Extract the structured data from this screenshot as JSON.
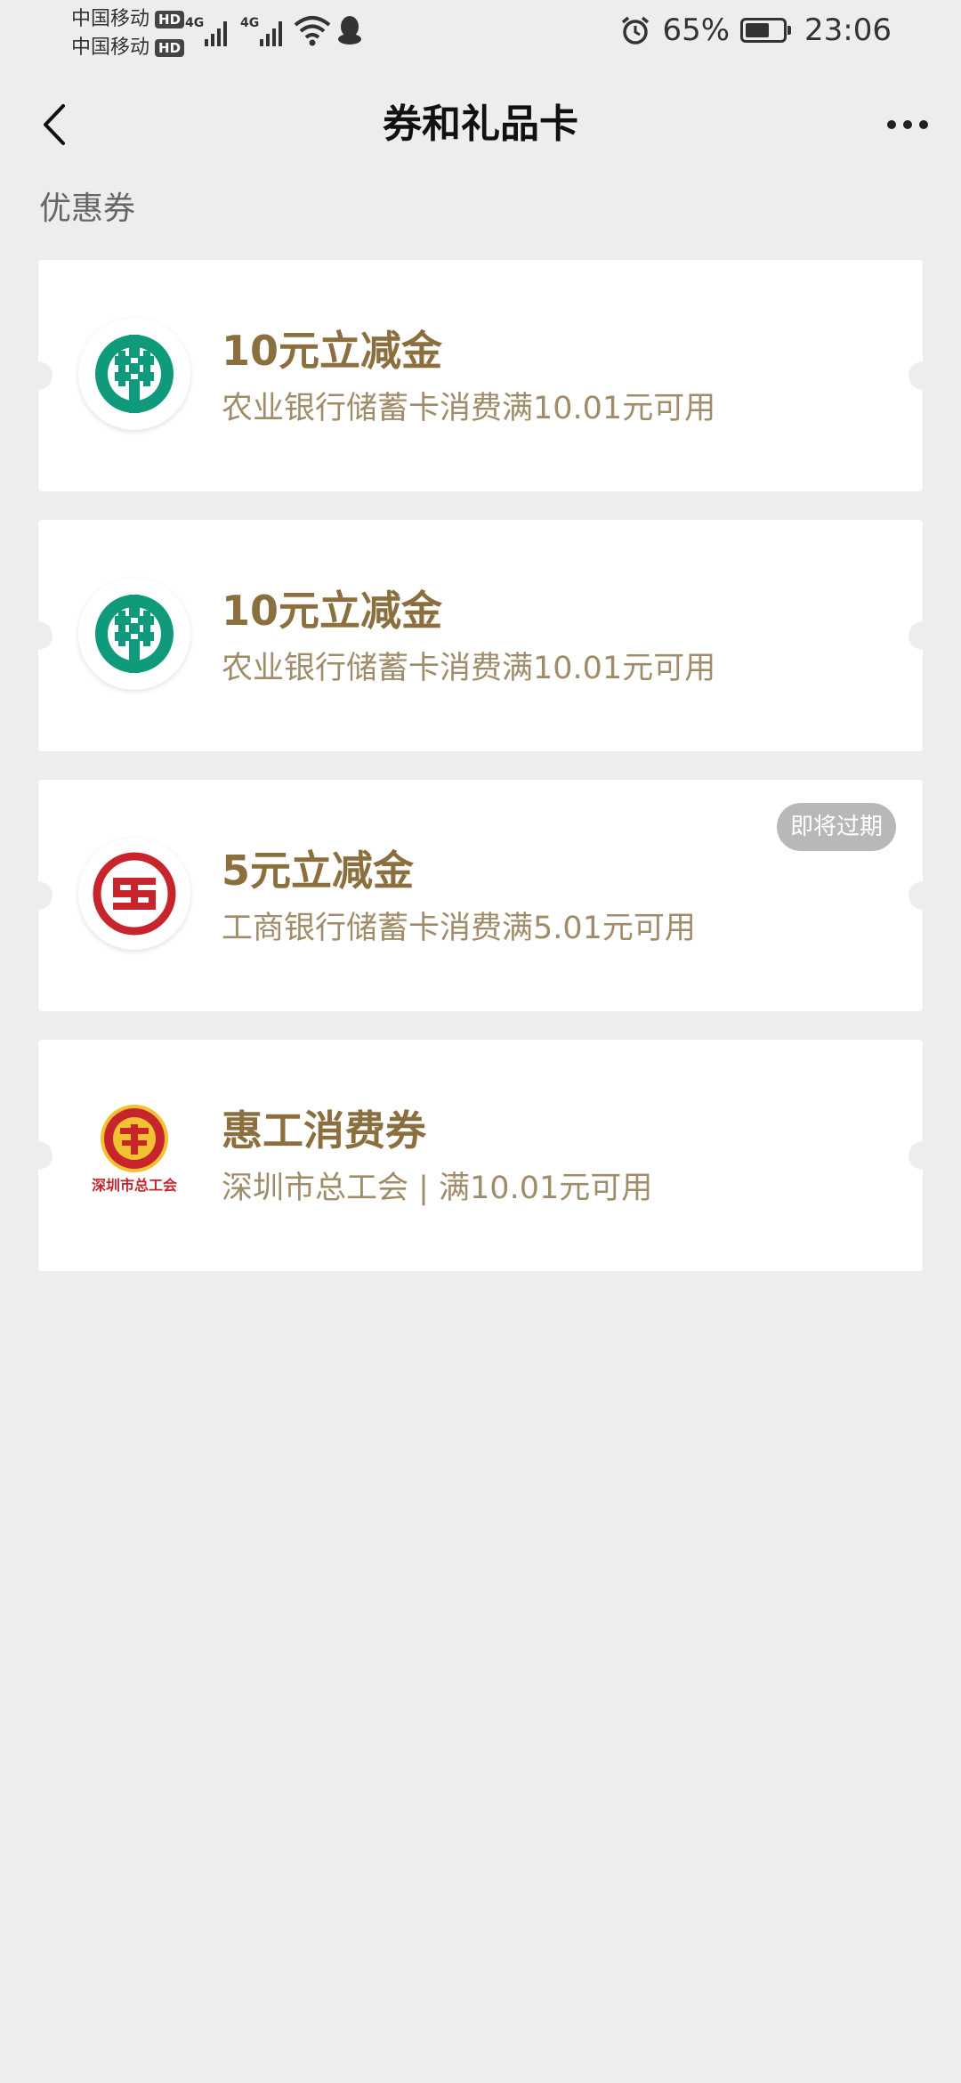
{
  "status_bar": {
    "carriers": [
      {
        "name": "中国移动",
        "hd": "HD",
        "net": "4G"
      },
      {
        "name": "中国移动",
        "hd": "HD",
        "net": "4G"
      }
    ],
    "battery_percent": "65%",
    "battery_level": 0.65,
    "time": "23:06"
  },
  "nav": {
    "title": "券和礼品卡",
    "back_icon": "chevron-left-icon",
    "more_icon": "more-dots-icon"
  },
  "section": {
    "title": "优惠券"
  },
  "coupons": [
    {
      "title": "10元立减金",
      "desc": "农业银行储蓄卡消费满10.01元可用",
      "logo": "abc-bank-logo",
      "badge": ""
    },
    {
      "title": "10元立减金",
      "desc": "农业银行储蓄卡消费满10.01元可用",
      "logo": "abc-bank-logo",
      "badge": ""
    },
    {
      "title": "5元立减金",
      "desc": "工商银行储蓄卡消费满5.01元可用",
      "logo": "icbc-bank-logo",
      "badge": "即将过期"
    },
    {
      "title": "惠工消费券",
      "desc": "深圳市总工会 | 满10.01元可用",
      "logo": "union-logo",
      "logo_caption": "深圳市总工会",
      "badge": ""
    }
  ],
  "colors": {
    "background": "#ededed",
    "coupon_title": "#8c6f3e",
    "coupon_desc": "#a08c69",
    "abc_green": "#0f9a7c",
    "icbc_red": "#c8242b",
    "union_red": "#c8242b",
    "union_yellow": "#f1c232",
    "badge_gray": "#b8b8b8"
  }
}
